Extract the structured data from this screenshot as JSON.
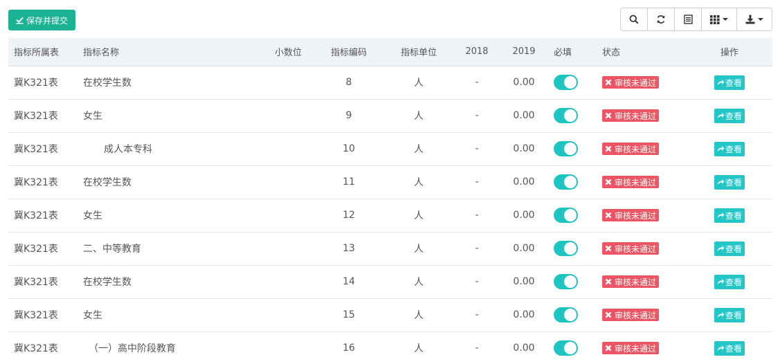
{
  "toolbar": {
    "save_label": "保存并提交",
    "icons": [
      "search-icon",
      "refresh-icon",
      "list-icon",
      "columns-icon",
      "download-icon"
    ]
  },
  "table": {
    "headers": {
      "table": "指标所属表",
      "name": "指标名称",
      "decimal": "小数位",
      "code": "指标编码",
      "unit": "指标单位",
      "y2018": "2018",
      "y2019": "2019",
      "required": "必填",
      "status": "状态",
      "action": "操作"
    },
    "rows": [
      {
        "table": "冀K321表",
        "name": "在校学生数",
        "decimal": "",
        "code": "8",
        "unit": "人",
        "y2018": "-",
        "y2019": "0.00",
        "required": true,
        "status": "审核未通过",
        "action": "查看"
      },
      {
        "table": "冀K321表",
        "name": "女生",
        "decimal": "",
        "code": "9",
        "unit": "人",
        "y2018": "-",
        "y2019": "0.00",
        "required": true,
        "status": "审核未通过",
        "action": "查看"
      },
      {
        "table": "冀K321表",
        "name": "成人本专科",
        "decimal": "",
        "code": "10",
        "unit": "人",
        "y2018": "-",
        "y2019": "0.00",
        "required": true,
        "status": "审核未通过",
        "action": "查看"
      },
      {
        "table": "冀K321表",
        "name": "在校学生数",
        "decimal": "",
        "code": "11",
        "unit": "人",
        "y2018": "-",
        "y2019": "0.00",
        "required": true,
        "status": "审核未通过",
        "action": "查看"
      },
      {
        "table": "冀K321表",
        "name": "女生",
        "decimal": "",
        "code": "12",
        "unit": "人",
        "y2018": "-",
        "y2019": "0.00",
        "required": true,
        "status": "审核未通过",
        "action": "查看"
      },
      {
        "table": "冀K321表",
        "name": "二、中等教育",
        "decimal": "",
        "code": "13",
        "unit": "人",
        "y2018": "-",
        "y2019": "0.00",
        "required": true,
        "status": "审核未通过",
        "action": "查看"
      },
      {
        "table": "冀K321表",
        "name": "在校学生数",
        "decimal": "",
        "code": "14",
        "unit": "人",
        "y2018": "-",
        "y2019": "0.00",
        "required": true,
        "status": "审核未通过",
        "action": "查看"
      },
      {
        "table": "冀K321表",
        "name": "女生",
        "decimal": "",
        "code": "15",
        "unit": "人",
        "y2018": "-",
        "y2019": "0.00",
        "required": true,
        "status": "审核未通过",
        "action": "查看"
      },
      {
        "table": "冀K321表",
        "name": "（一）高中阶段教育",
        "decimal": "",
        "code": "16",
        "unit": "人",
        "y2018": "-",
        "y2019": "0.00",
        "required": true,
        "status": "审核未通过",
        "action": "查看"
      }
    ]
  },
  "colors": {
    "accent": "#1ab394",
    "toggle": "#1dc5c0",
    "danger": "#ed5565",
    "info": "#23c6c8",
    "header_bg": "#eff2f6"
  }
}
